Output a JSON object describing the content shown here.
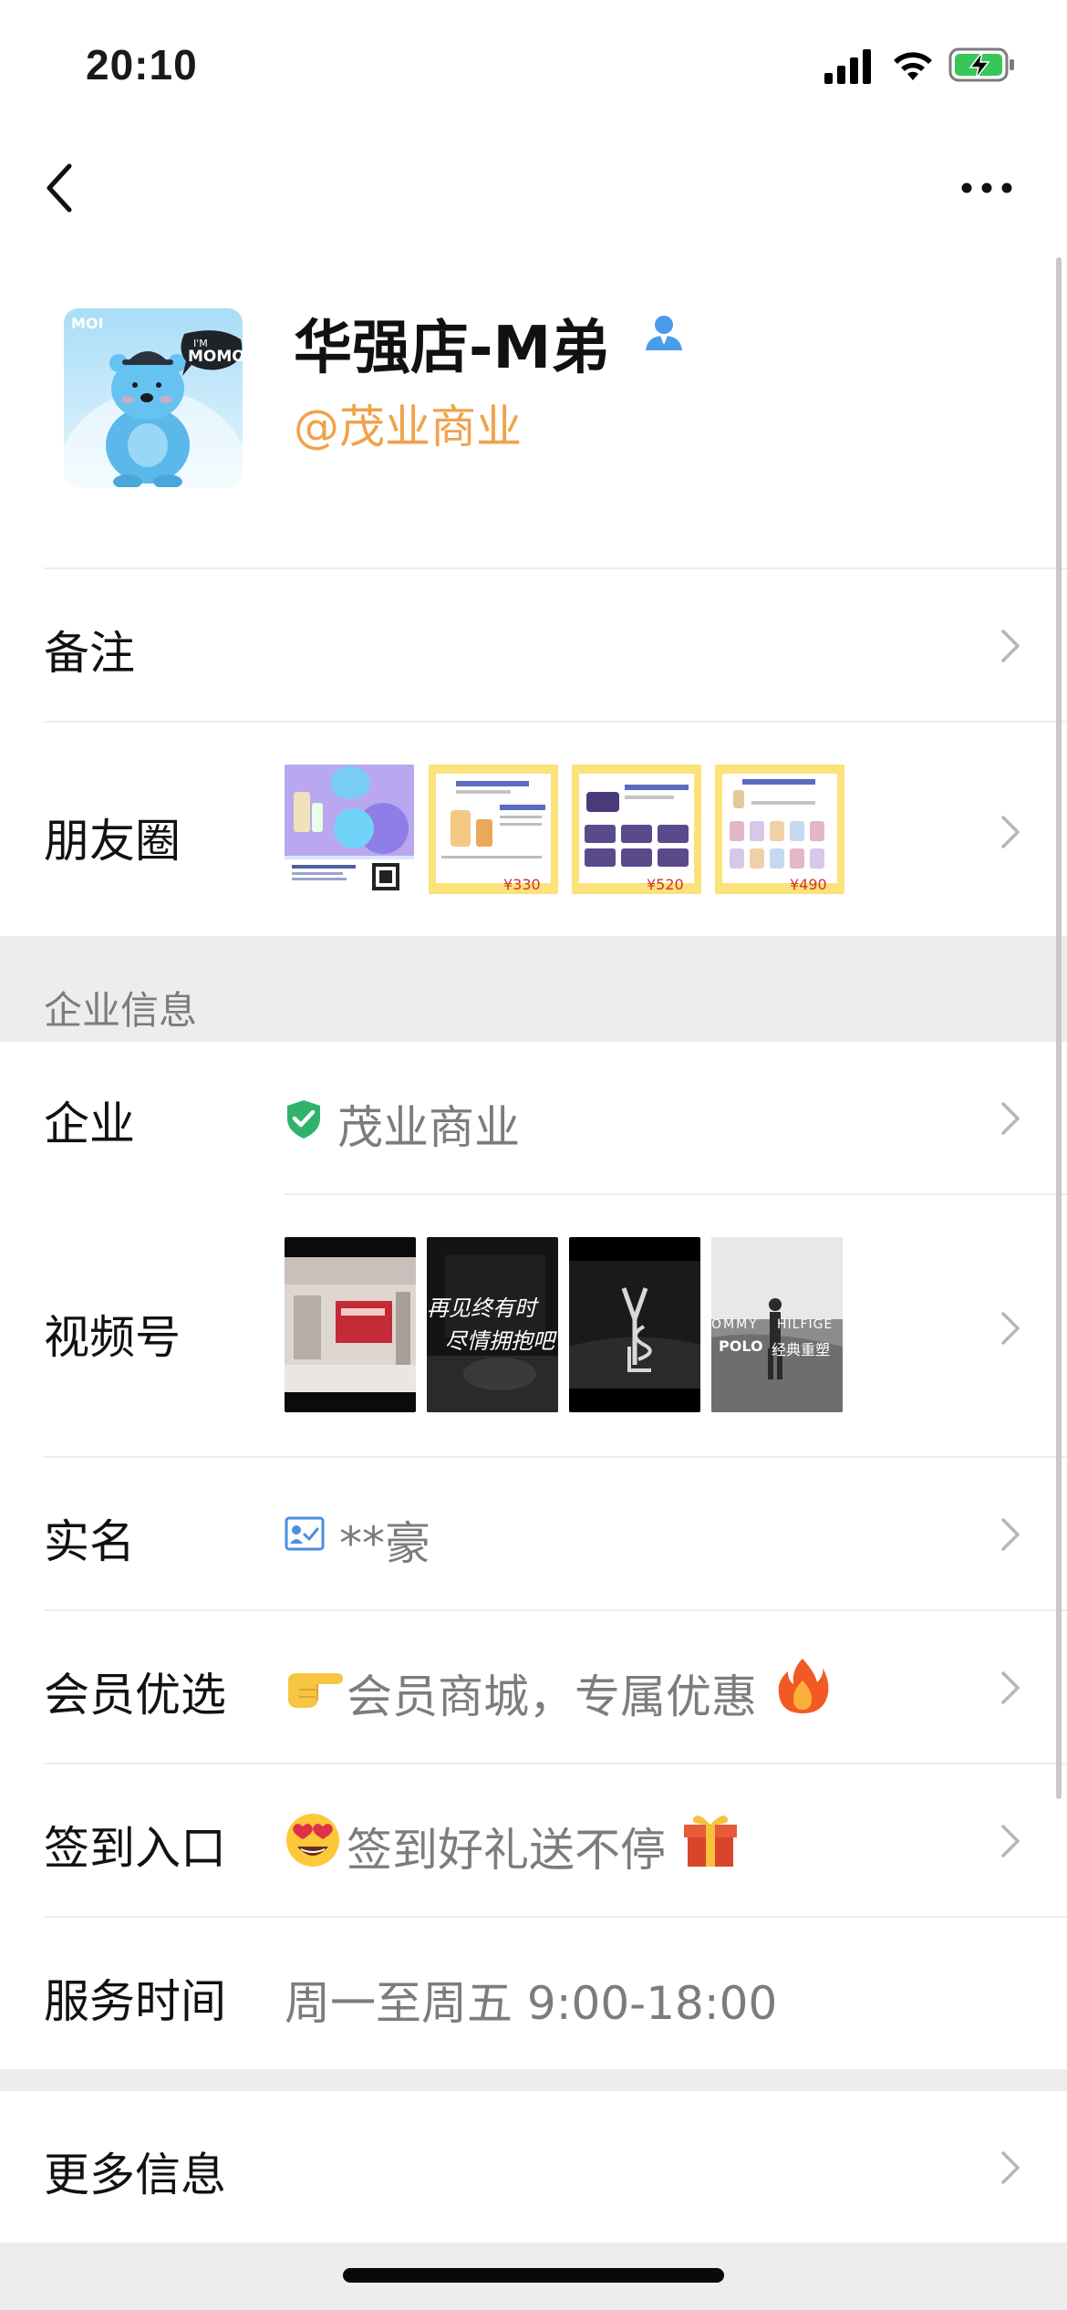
{
  "status_bar": {
    "time": "20:10"
  },
  "profile": {
    "name": "华强店-M弟",
    "corp": "@茂业商业",
    "avatar_text_top": "MOI",
    "avatar_bubble": "MOMO",
    "avatar_bubble_small": "I'M"
  },
  "rows": {
    "remark_label": "备注",
    "moments_label": "朋友圈",
    "moments_prices": [
      "¥330",
      "¥520",
      "¥490"
    ],
    "section_title": "企业信息",
    "company_label": "企业",
    "company_value": "茂业商业",
    "channels_label": "视频号",
    "channels_caption_1": "再见终有时",
    "channels_caption_2": "尽情拥抱吧",
    "channels_caption_4a": "OMMY",
    "channels_caption_4b": "HILFIGE",
    "channels_caption_4c": "POLO",
    "channels_caption_4d": "经典重塑",
    "realname_label": "实名",
    "realname_value": "**豪",
    "member_label": "会员优选",
    "member_value": "会员商城，专属优惠",
    "checkin_label": "签到入口",
    "checkin_value": "签到好礼送不停",
    "service_label": "服务时间",
    "service_value": "周一至周五 9:00-18:00",
    "more_label": "更多信息"
  },
  "colors": {
    "accent_orange": "#f0a24b",
    "verified_green": "#2fb36b",
    "section_bg": "#ededed",
    "secondary_text": "#7c7c7c"
  },
  "icons": {
    "back": "chevron-left-icon",
    "more": "more-dots-icon",
    "badge": "person-badge-icon",
    "row_arrow": "chevron-right-icon",
    "verified": "shield-check-icon",
    "realname": "id-card-icon",
    "member_emoji": "pointing-hand-emoji",
    "fire_emoji": "fire-emoji",
    "checkin_emoji": "heart-eyes-emoji",
    "gift_emoji": "gift-emoji"
  }
}
